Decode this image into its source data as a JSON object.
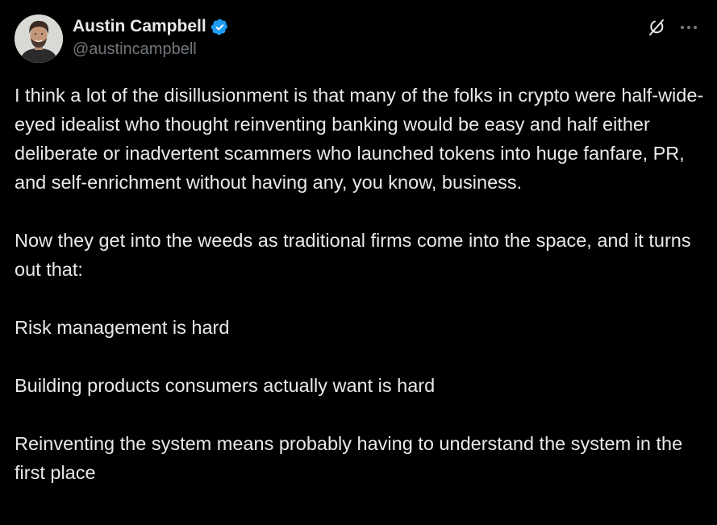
{
  "author": {
    "display_name": "Austin Campbell",
    "handle": "@austincampbell",
    "verified": true,
    "verified_color": "#1d9bf0"
  },
  "actions": {
    "grok_icon": "grok-icon",
    "more_icon": "more-horizontal-icon"
  },
  "tweet": {
    "paragraphs": [
      "I think a lot of the disillusionment is that many of the folks in crypto were half-wide-eyed idealist who thought reinventing banking would be easy and half either deliberate or inadvertent scammers who launched tokens into huge fanfare, PR, and self-enrichment without having any, you know, business.",
      "Now they get into the weeds as traditional firms come into the space, and it turns out that:",
      "Risk management is hard",
      "Building products consumers actually want is hard",
      "Reinventing the system means probably having to understand the system in the first place"
    ]
  },
  "colors": {
    "background": "#000000",
    "text": "#e7e9ea",
    "secondary_text": "#71767b"
  }
}
